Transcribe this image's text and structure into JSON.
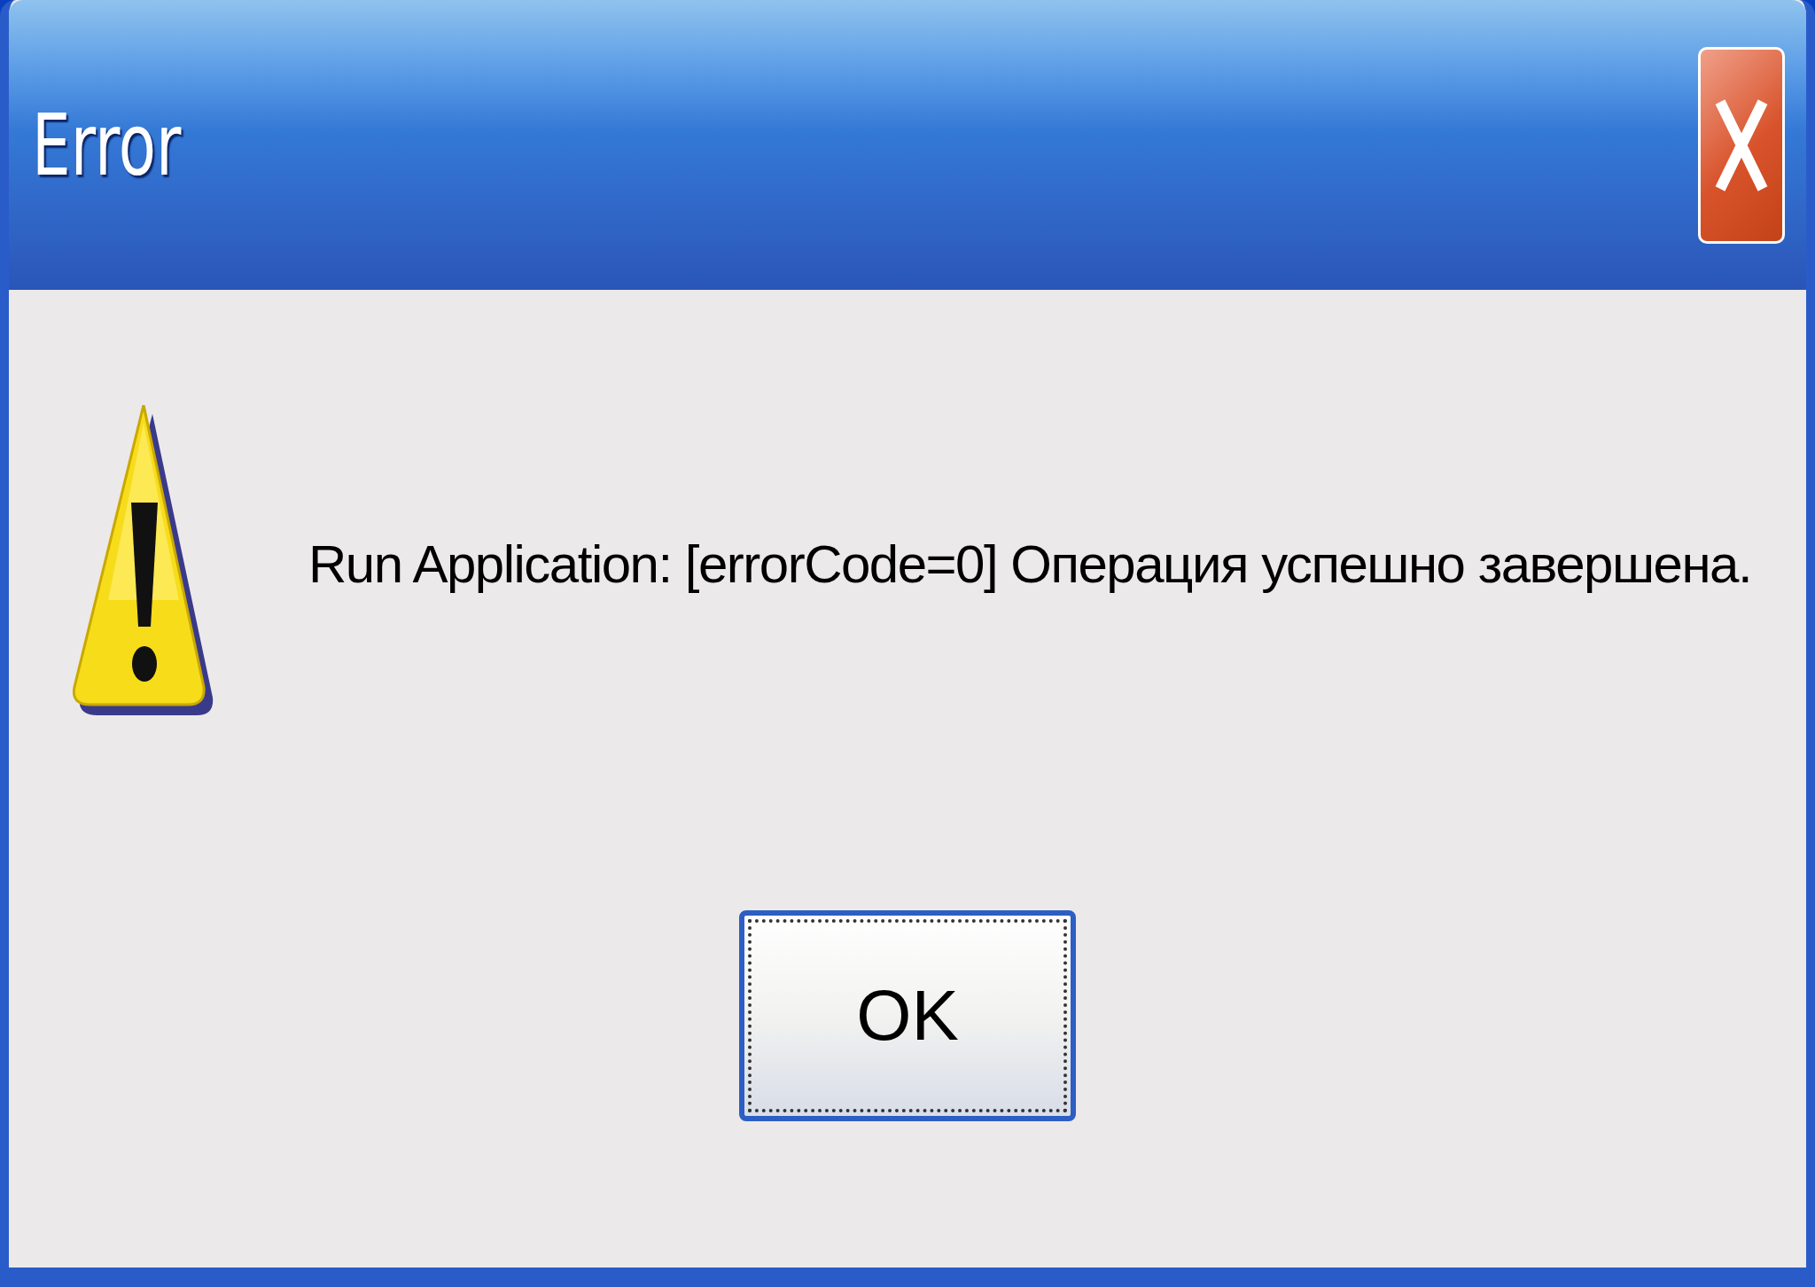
{
  "window": {
    "title": "Error"
  },
  "message": {
    "kind": "warning",
    "text": "Run Application: [errorCode=0] Операция успешно завершена."
  },
  "buttons": [
    {
      "label": "OK",
      "focused": true
    }
  ]
}
